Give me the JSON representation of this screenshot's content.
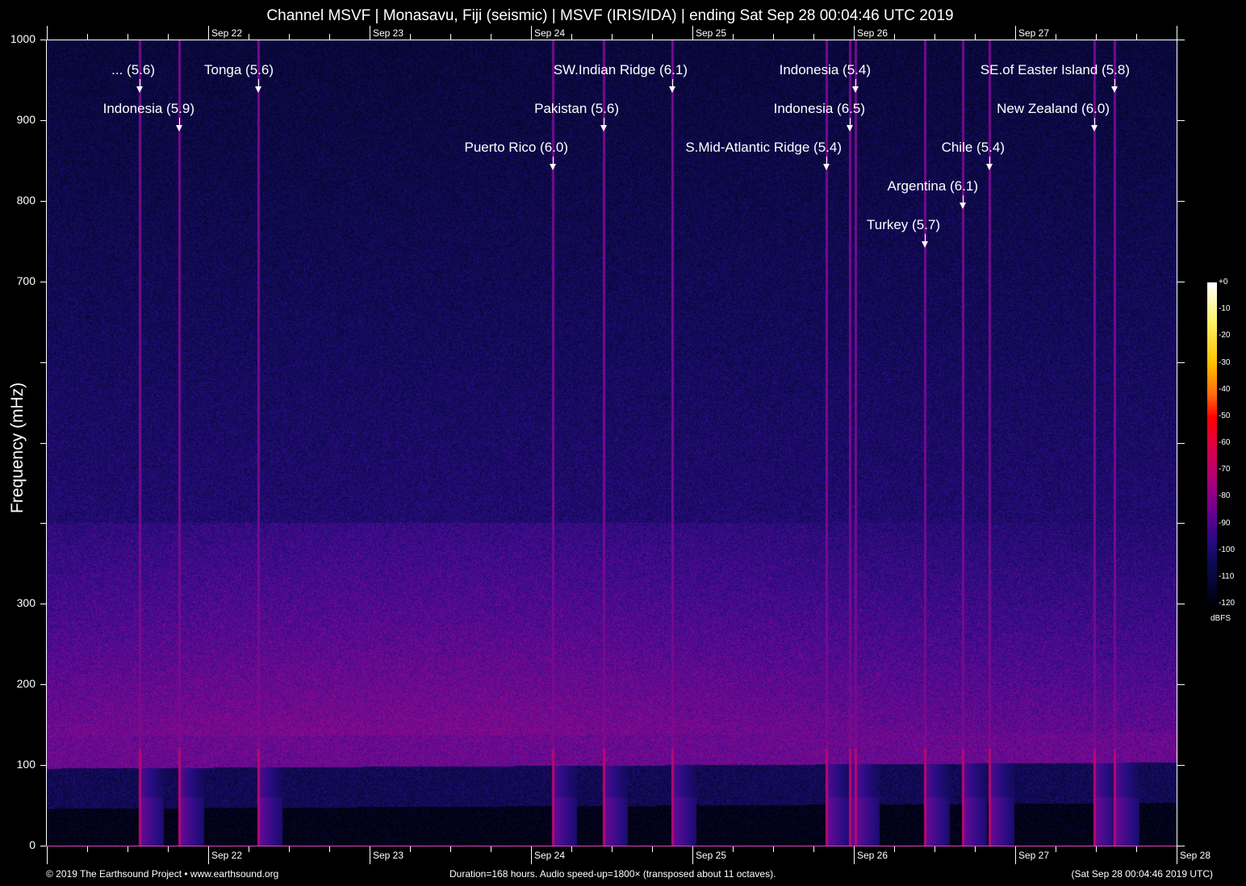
{
  "chart_data": {
    "type": "heatmap",
    "title": "Channel MSVF | Monasavu, Fiji (seismic) | MSVF (IRIS/IDA) | ending Sat Sep 28 00:04:46 UTC 2019",
    "ylabel": "Frequency (mHz)",
    "xlabel": "",
    "ylim": [
      0,
      1000
    ],
    "xlim_hours": [
      0,
      168
    ],
    "y_ticks": [
      0,
      100,
      200,
      300,
      400,
      500,
      600,
      700,
      800,
      900,
      1000
    ],
    "y_tick_labels": [
      "0",
      "100",
      "200",
      "300",
      "",
      "",
      "",
      "700",
      "800",
      "900",
      "1000"
    ],
    "x_day_labels": [
      {
        "label": "Sep 22",
        "hours": 24
      },
      {
        "label": "Sep 23",
        "hours": 48
      },
      {
        "label": "Sep 24",
        "hours": 72
      },
      {
        "label": "Sep 25",
        "hours": 96
      },
      {
        "label": "Sep 26",
        "hours": 120
      },
      {
        "label": "Sep 27",
        "hours": 144
      }
    ],
    "x_end_label": "Sep 28",
    "colorbar": {
      "unit": "dBFS",
      "range": [
        -120,
        0
      ],
      "ticks": [
        "+0",
        "-10",
        "-20",
        "-30",
        "-40",
        "-50",
        "-60",
        "-70",
        "-80",
        "-90",
        "-100",
        "-110",
        "-120"
      ]
    },
    "events": [
      {
        "label": "... (5.6)",
        "hours": 13.8,
        "row": 0
      },
      {
        "label": "Indonesia (5.9)",
        "hours": 19.7,
        "row": 1
      },
      {
        "label": "Tonga (5.6)",
        "hours": 31.4,
        "row": 0
      },
      {
        "label": "Puerto Rico (6.0)",
        "hours": 75.2,
        "row": 2
      },
      {
        "label": "Pakistan (5.6)",
        "hours": 82.8,
        "row": 1
      },
      {
        "label": "SW.Indian Ridge (6.1)",
        "hours": 93.0,
        "row": 0
      },
      {
        "label": "S.Mid-Atlantic Ridge (5.4)",
        "hours": 115.9,
        "row": 2
      },
      {
        "label": "Indonesia (6.5)",
        "hours": 119.4,
        "row": 1
      },
      {
        "label": "Indonesia (5.4)",
        "hours": 120.2,
        "row": 0
      },
      {
        "label": "Turkey (5.7)",
        "hours": 130.6,
        "row": 4
      },
      {
        "label": "Argentina (6.1)",
        "hours": 136.2,
        "row": 3
      },
      {
        "label": "Chile (5.4)",
        "hours": 140.2,
        "row": 2
      },
      {
        "label": "New Zealand (6.0)",
        "hours": 155.8,
        "row": 1
      },
      {
        "label": "SE.of Easter Island (5.8)",
        "hours": 158.8,
        "row": 0
      }
    ]
  },
  "footer": {
    "copyright": "© 2019 The Earthsound Project • www.earthsound.org",
    "duration": "Duration=168 hours. Audio speed-up=1800× (transposed about 11 octaves).",
    "timestamp": "(Sat Sep 28 00:04:46 2019 UTC)"
  }
}
